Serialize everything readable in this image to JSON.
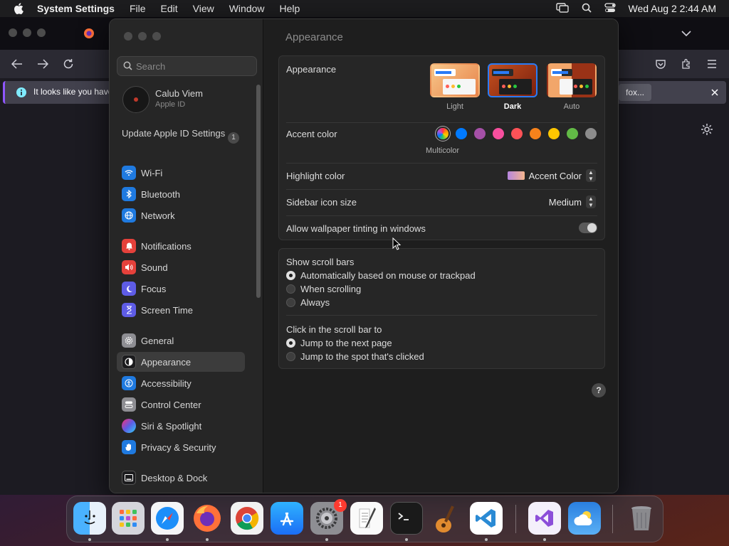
{
  "menubar": {
    "app_name": "System Settings",
    "menus": [
      "File",
      "Edit",
      "View",
      "Window",
      "Help"
    ],
    "clock": "Wed Aug 2  2:44 AM"
  },
  "browser": {
    "notice_text": "It looks like you have",
    "notice_button": "fox..."
  },
  "sidebar": {
    "search_placeholder": "Search",
    "user_name": "Calub Viem",
    "user_sub": "Apple ID",
    "update_text": "Update Apple ID Settings",
    "update_badge": "1",
    "items": [
      {
        "label": "Wi-Fi",
        "icon": "wifi-icon",
        "color": "#1f7ae0"
      },
      {
        "label": "Bluetooth",
        "icon": "bluetooth-icon",
        "color": "#1f7ae0"
      },
      {
        "label": "Network",
        "icon": "globe-icon",
        "color": "#1f7ae0"
      },
      {
        "label": "Notifications",
        "icon": "bell-icon",
        "color": "#e5413b"
      },
      {
        "label": "Sound",
        "icon": "speaker-icon",
        "color": "#e5413b"
      },
      {
        "label": "Focus",
        "icon": "moon-icon",
        "color": "#5e5ce6"
      },
      {
        "label": "Screen Time",
        "icon": "hourglass-icon",
        "color": "#5e5ce6"
      },
      {
        "label": "General",
        "icon": "gear-icon",
        "color": "#8e8e93"
      },
      {
        "label": "Appearance",
        "icon": "appearance-icon",
        "color": "#1c1c1e"
      },
      {
        "label": "Accessibility",
        "icon": "accessibility-icon",
        "color": "#1f7ae0"
      },
      {
        "label": "Control Center",
        "icon": "control-center-icon",
        "color": "#8e8e93"
      },
      {
        "label": "Siri & Spotlight",
        "icon": "siri-icon",
        "color": "#b84fd6"
      },
      {
        "label": "Privacy & Security",
        "icon": "hand-icon",
        "color": "#1f7ae0"
      },
      {
        "label": "Desktop & Dock",
        "icon": "dock-icon",
        "color": "#1c1c1e"
      }
    ]
  },
  "main": {
    "title": "Appearance",
    "appearance_label": "Appearance",
    "themes": [
      {
        "label": "Light",
        "selected": false
      },
      {
        "label": "Dark",
        "selected": true
      },
      {
        "label": "Auto",
        "selected": false
      }
    ],
    "accent_label": "Accent color",
    "accent_selected_label": "Multicolor",
    "accent_colors": [
      "#ff6ac1",
      "#007aff",
      "#a550a7",
      "#f74f9e",
      "#ff5257",
      "#f7821b",
      "#ffc600",
      "#62ba46",
      "#8c8c8c"
    ],
    "highlight_label": "Highlight color",
    "highlight_value": "Accent Color",
    "sidebar_icon_label": "Sidebar icon size",
    "sidebar_icon_value": "Medium",
    "tinting_label": "Allow wallpaper tinting in windows",
    "tinting_on": true,
    "scroll_label": "Show scroll bars",
    "scroll_options": [
      {
        "label": "Automatically based on mouse or trackpad",
        "selected": true
      },
      {
        "label": "When scrolling",
        "selected": false
      },
      {
        "label": "Always",
        "selected": false
      }
    ],
    "click_label": "Click in the scroll bar to",
    "click_options": [
      {
        "label": "Jump to the next page",
        "selected": true
      },
      {
        "label": "Jump to the spot that's clicked",
        "selected": false
      }
    ],
    "help_label": "?"
  },
  "dock": {
    "apps": [
      {
        "name": "finder-icon",
        "glyph": "☺",
        "color": "#2f8cf5"
      },
      {
        "name": "launchpad-icon",
        "glyph": "▦",
        "color": "#d0d0d8"
      },
      {
        "name": "safari-icon",
        "glyph": "✦",
        "color": "#1c8ef9"
      },
      {
        "name": "firefox-icon",
        "glyph": "◉",
        "color": "#ff7139"
      },
      {
        "name": "chrome-icon",
        "glyph": "◎",
        "color": "#e8e8e8"
      },
      {
        "name": "app-store-icon",
        "glyph": "A",
        "color": "#1b7cf5"
      },
      {
        "name": "system-settings-icon",
        "glyph": "⚙",
        "color": "#7a7a80"
      },
      {
        "name": "textedit-icon",
        "glyph": "✎",
        "color": "#f2f2f2"
      },
      {
        "name": "terminal-icon",
        "glyph": ">_",
        "color": "#1a1a1a"
      },
      {
        "name": "garageband-icon",
        "glyph": "♪",
        "color": "#a0522d"
      },
      {
        "name": "vscode-icon",
        "glyph": "❮❯",
        "color": "#ffffff"
      },
      {
        "name": "visual-studio-icon",
        "glyph": "∞",
        "color": "#f4f0fb"
      },
      {
        "name": "weather-icon",
        "glyph": "☁",
        "color": "#2f86e0"
      },
      {
        "name": "trash-icon",
        "glyph": "🗑",
        "color": "#8a8a8e"
      }
    ],
    "badge": "1"
  }
}
